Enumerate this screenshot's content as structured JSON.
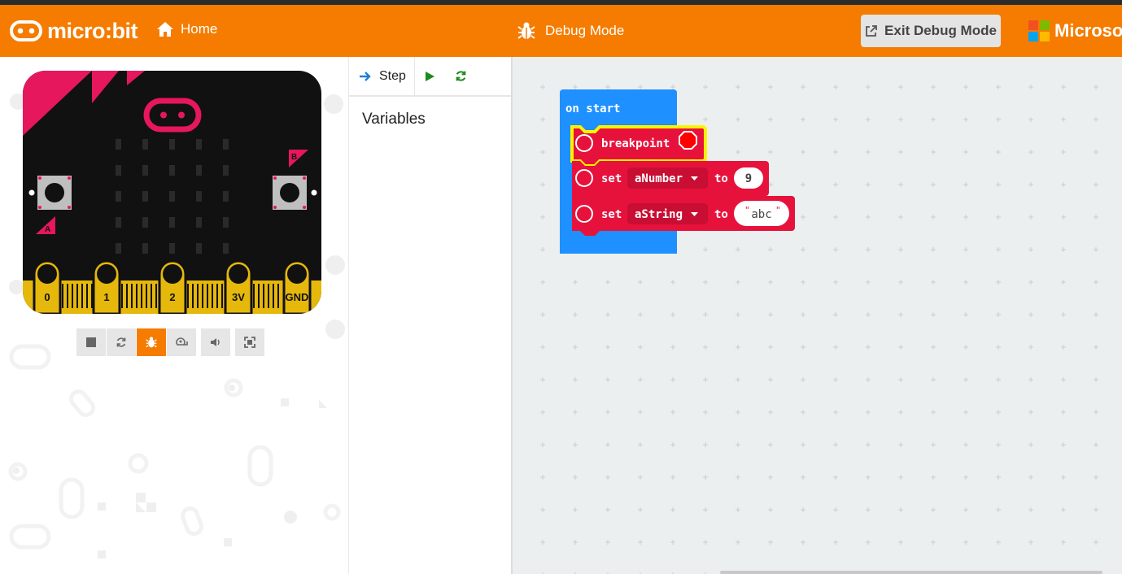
{
  "header": {
    "brand": "micro:bit",
    "home_label": "Home",
    "mode_label": "Debug Mode",
    "exit_button": "Exit Debug Mode",
    "microsoft": "Microsof",
    "brand_color": "#f57c00"
  },
  "simulator": {
    "buttons": {
      "a": "A",
      "b": "B"
    },
    "pins": [
      "0",
      "1",
      "2",
      "3V",
      "GND"
    ],
    "controls": [
      {
        "icon": "stop-icon"
      },
      {
        "icon": "restart-icon"
      },
      {
        "icon": "debug-bug-icon",
        "active": true
      },
      {
        "icon": "slow-motion-icon"
      },
      {
        "icon": "sound-icon"
      },
      {
        "icon": "fullscreen-icon"
      }
    ]
  },
  "debugger": {
    "step_label": "Step",
    "play_icon": "play-icon",
    "restart_icon": "restart-icon",
    "variables_title": "Variables"
  },
  "blocks": {
    "on_start": "on start",
    "breakpoint": "breakpoint",
    "set1": {
      "keyword": "set",
      "variable": "aNumber",
      "to": "to",
      "value": "9"
    },
    "set2": {
      "keyword": "set",
      "variable": "aString",
      "to": "to",
      "value": "abc"
    },
    "colors": {
      "event": "#1e90ff",
      "variables": "#e6123c",
      "highlight": "#fff200"
    }
  }
}
